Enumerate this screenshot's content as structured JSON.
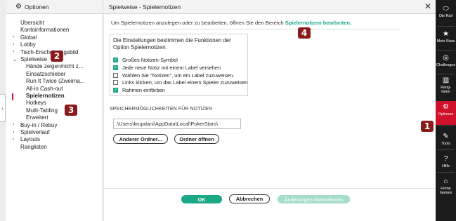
{
  "header": {
    "options_label": "Optionen",
    "title": "Spielweise - Spielernotizen",
    "close_icon": "close-icon"
  },
  "nav": {
    "items": [
      {
        "label": "Übersicht",
        "caret": false,
        "indent": 0
      },
      {
        "label": "Kontoinformationen",
        "caret": false,
        "indent": 0
      },
      {
        "label": "Global",
        "caret": true,
        "indent": 0
      },
      {
        "label": "Lobby",
        "caret": true,
        "indent": 0
      },
      {
        "label": "Tisch-Erscheinungsbild",
        "caret": true,
        "indent": 0
      },
      {
        "label": "Spielweise",
        "caret": true,
        "indent": 0
      },
      {
        "label": "Hände zeigen/nicht z...",
        "caret": false,
        "indent": 1
      },
      {
        "label": "Einsatzschieber",
        "caret": false,
        "indent": 1
      },
      {
        "label": "Run It Twice (Zweima...",
        "caret": false,
        "indent": 1
      },
      {
        "label": "All-in Cash-out",
        "caret": false,
        "indent": 1
      },
      {
        "label": "Spielernotizen",
        "caret": false,
        "indent": 1,
        "active": true
      },
      {
        "label": "Hotkeys",
        "caret": false,
        "indent": 1
      },
      {
        "label": "Multi-Tabling",
        "caret": false,
        "indent": 1
      },
      {
        "label": "Erweitert",
        "caret": false,
        "indent": 1
      },
      {
        "label": "Buy-in / Rebuy",
        "caret": true,
        "indent": 0
      },
      {
        "label": "Spielverlauf",
        "caret": true,
        "indent": 0
      },
      {
        "label": "Layouts",
        "caret": true,
        "indent": 0
      },
      {
        "label": "Ranglisten",
        "caret": false,
        "indent": 0
      }
    ]
  },
  "main": {
    "intro_text": "Um Spielernotizen anzulegen oder zu bearbeiten, öffnen Sie den Bereich",
    "intro_link": "Spielernotizen bearbeiten.",
    "settings_title": "Die Einstellungen bestimmen die Funktionen der Option Spielernotizen.",
    "checkboxes": [
      {
        "label": "Großes Notizen-Symbol",
        "checked": true
      },
      {
        "label": "Jede neue Notiz mit einem Label versehen",
        "checked": true
      },
      {
        "label": "Wählen Sie \"Notizen\", um ein Label zuzuweisen.",
        "checked": false
      },
      {
        "label": "Links klicken, um das Label einem Spieler zuzuweisen",
        "checked": false
      },
      {
        "label": "Rahmen einfärben",
        "checked": true
      }
    ],
    "storage_label": "SPEICHERMÖGLICHKEITEN FÜR NOTIZEN",
    "storage_path": ":\\Users\\krupdani\\AppData\\Local\\PokerStars\\",
    "other_folder_button": "Anderer Ordner...",
    "open_folder_button": "Ordner öffnen"
  },
  "footer": {
    "ok": "OK",
    "cancel": "Abbrechen",
    "apply": "Änderungen übernehmen"
  },
  "rail": {
    "items": [
      {
        "icon": "die-rail-icon",
        "glyph": "⬭",
        "label": "Die Rail"
      },
      {
        "icon": "star-icon",
        "glyph": "★",
        "label": "Mein Stars"
      },
      {
        "icon": "challenges-icon",
        "glyph": "◎",
        "label": "Challenges"
      },
      {
        "icon": "leaderboard-icon",
        "glyph": "▥",
        "label": "Rang-\nlisten"
      },
      {
        "icon": "gear-icon",
        "glyph": "⚙",
        "label": "Optionen",
        "active": true
      },
      {
        "icon": "wrench-icon",
        "glyph": "✎",
        "label": "Tools"
      },
      {
        "icon": "help-icon",
        "glyph": "?",
        "label": "Hilfe"
      },
      {
        "icon": "home-icon",
        "glyph": "⌂",
        "label": "Home\nGames"
      }
    ]
  },
  "markers": [
    "1",
    "2",
    "3",
    "4"
  ],
  "colors": {
    "accent": "#1aa886",
    "active": "#d0112b",
    "marker": "#8b1a1a"
  }
}
